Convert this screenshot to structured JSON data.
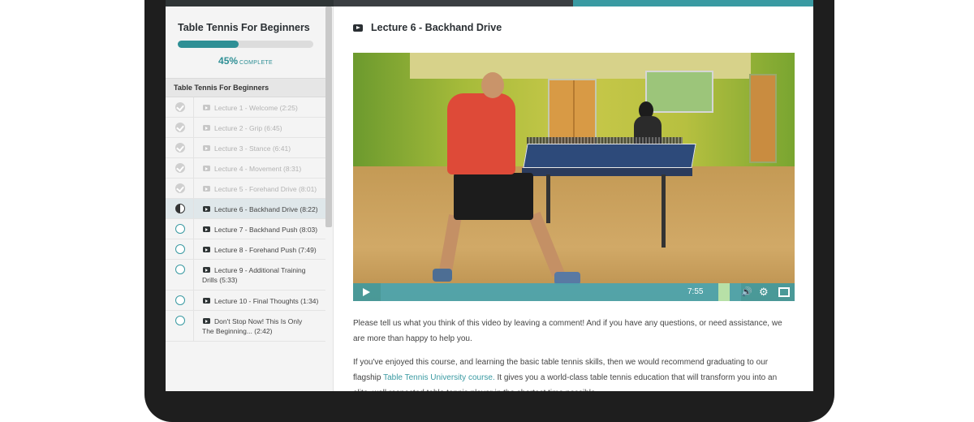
{
  "course": {
    "title": "Table Tennis For Beginners",
    "progress_percent": 45,
    "progress_label": "45%",
    "progress_word": "COMPLETE"
  },
  "sidebar": {
    "section_title": "Table Tennis For Beginners",
    "lectures": [
      {
        "label": "Lecture 1 - Welcome (2:25)",
        "status": "complete"
      },
      {
        "label": "Lecture 2 - Grip (6:45)",
        "status": "complete"
      },
      {
        "label": "Lecture 3 - Stance (6:41)",
        "status": "complete"
      },
      {
        "label": "Lecture 4 - Movement (8:31)",
        "status": "complete"
      },
      {
        "label": "Lecture 5 - Forehand Drive (8:01)",
        "status": "complete"
      },
      {
        "label": "Lecture 6 - Backhand Drive (8:22)",
        "status": "in-progress"
      },
      {
        "label": "Lecture 7 - Backhand Push (8:03)",
        "status": "incomplete"
      },
      {
        "label": "Lecture 8 - Forehand Push (7:49)",
        "status": "incomplete"
      },
      {
        "label": "Lecture 9 - Additional Training Drills (5:33)",
        "status": "incomplete"
      },
      {
        "label": "Lecture 10 - Final Thoughts (1:34)",
        "status": "incomplete"
      },
      {
        "label": "Don't Stop Now! This Is Only The Beginning... (2:42)",
        "status": "incomplete"
      }
    ]
  },
  "main": {
    "lecture_title": "Lecture 6 - Backhand Drive",
    "video": {
      "timecode": "7:55"
    },
    "paragraph1": "Please tell us what you think of this video by leaving a comment! And if you have any questions, or need assistance, we are more than happy to help you.",
    "paragraph2_before": "If you've enjoyed this course, and learning the basic table tennis skills, then we would recommend graduating to our flagship ",
    "paragraph2_link": "Table Tennis University course.",
    "paragraph2_after": " It gives you a world-class table tennis education that will transform you into an elite, well respected table tennis player in the shortest time possible."
  },
  "icons": {
    "video": "video-icon",
    "play": "play-icon",
    "volume": "volume-icon",
    "settings": "gear-icon",
    "fullscreen": "fullscreen-icon"
  },
  "colors": {
    "accent": "#3a9aa2",
    "progress": "#2e8f95",
    "active_row": "#dfe7ea"
  }
}
